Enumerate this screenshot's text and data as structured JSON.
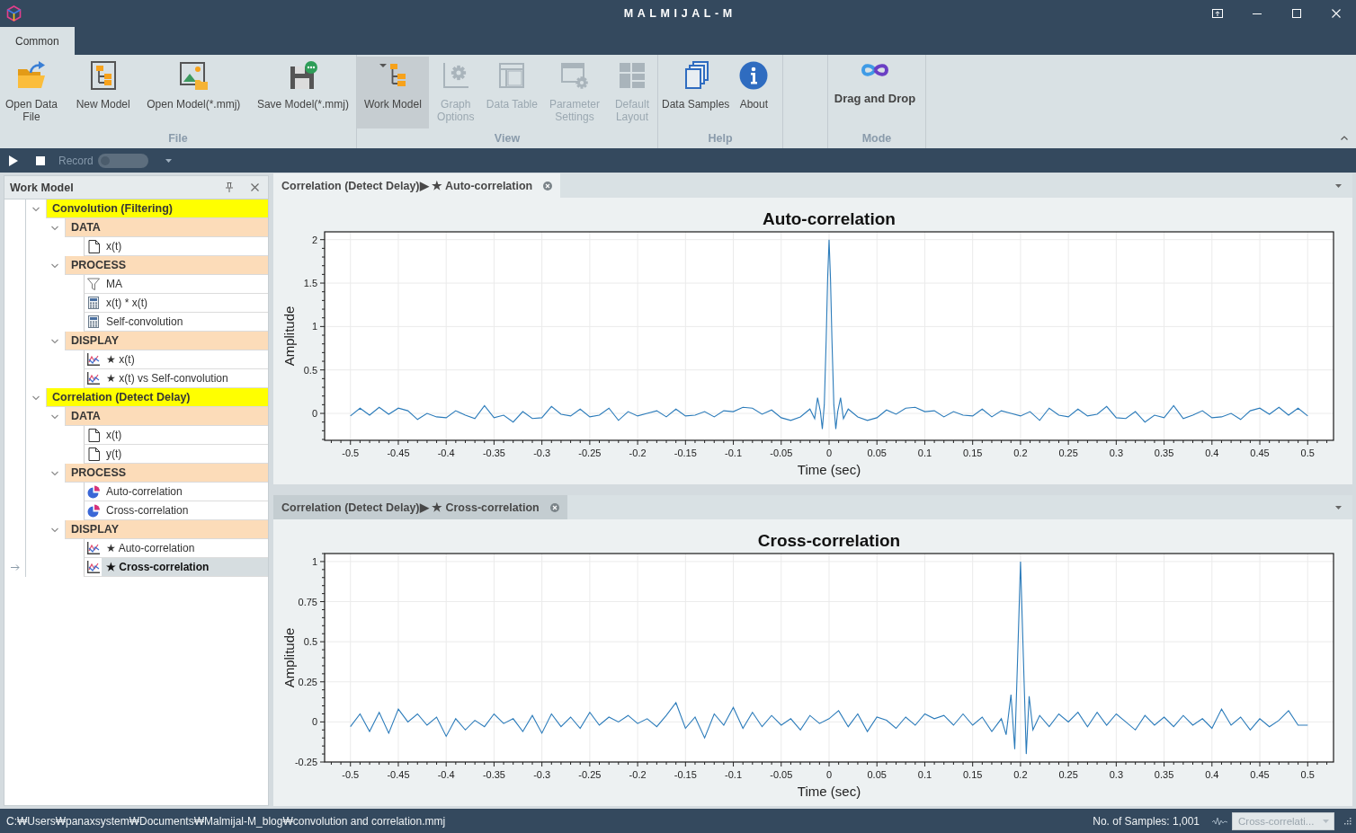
{
  "window": {
    "title": "MALMIJAL-M"
  },
  "ribbon": {
    "tabs": [
      {
        "label": "Common",
        "selected": true
      }
    ],
    "groups": [
      {
        "label": "File",
        "buttons": [
          {
            "kind": "open",
            "label": "Open Data File",
            "active": false,
            "disabled": false
          },
          {
            "kind": "new",
            "label": "New Model",
            "active": false,
            "disabled": false
          },
          {
            "kind": "load",
            "label": "Open Model(*.mmj)",
            "active": false,
            "disabled": false
          },
          {
            "kind": "save",
            "label": "Save Model(*.mmj)",
            "active": false,
            "disabled": false
          }
        ]
      },
      {
        "label": "View",
        "buttons": [
          {
            "kind": "tree",
            "label": "Work Model",
            "active": true,
            "disabled": false
          },
          {
            "kind": "graph",
            "label": "Graph Options",
            "active": false,
            "disabled": true
          },
          {
            "kind": "table",
            "label": "Data Table",
            "active": false,
            "disabled": true
          },
          {
            "kind": "params",
            "label": "Parameter Settings",
            "active": false,
            "disabled": true
          },
          {
            "kind": "layout",
            "label": "Default Layout",
            "active": false,
            "disabled": true
          }
        ]
      },
      {
        "label": "Help",
        "buttons": [
          {
            "kind": "samples",
            "label": "Data Samples",
            "active": false,
            "disabled": false
          },
          {
            "kind": "about",
            "label": "About",
            "active": false,
            "disabled": false
          }
        ]
      },
      {
        "label": "Mode",
        "buttons": [
          {
            "kind": "mode",
            "label": "Drag and Drop",
            "active": false,
            "disabled": false
          }
        ]
      }
    ]
  },
  "toolbar": {
    "record": {
      "label": "Record",
      "disabled": true,
      "on": false
    }
  },
  "work_model": {
    "title": "Work Model",
    "tree": [
      {
        "label": "Convolution (Filtering)",
        "kind": "model",
        "expanded": true,
        "selected": false,
        "children": [
          {
            "label": "DATA",
            "kind": "group",
            "expanded": true,
            "selected": false,
            "children": [
              {
                "label": "x(t)",
                "kind": "data",
                "selected": false
              }
            ]
          },
          {
            "label": "PROCESS",
            "kind": "group",
            "expanded": true,
            "selected": false,
            "children": [
              {
                "label": "MA",
                "kind": "filter",
                "selected": false
              },
              {
                "label": "x(t) * x(t)",
                "kind": "calc",
                "selected": false
              },
              {
                "label": "Self-convolution",
                "kind": "calc",
                "selected": false
              }
            ]
          },
          {
            "label": "DISPLAY",
            "kind": "group",
            "expanded": true,
            "selected": false,
            "children": [
              {
                "label": "★ x(t)",
                "kind": "display",
                "selected": false
              },
              {
                "label": "★ x(t) vs Self-convolution",
                "kind": "display",
                "selected": false
              }
            ]
          }
        ]
      },
      {
        "label": "Correlation (Detect Delay)",
        "kind": "model",
        "expanded": true,
        "selected": false,
        "children": [
          {
            "label": "DATA",
            "kind": "group",
            "expanded": true,
            "selected": false,
            "children": [
              {
                "label": "x(t)",
                "kind": "data",
                "selected": false
              },
              {
                "label": "y(t)",
                "kind": "data",
                "selected": false
              }
            ]
          },
          {
            "label": "PROCESS",
            "kind": "group",
            "expanded": true,
            "selected": false,
            "children": [
              {
                "label": "Auto-correlation",
                "kind": "correlation",
                "selected": false
              },
              {
                "label": "Cross-correlation",
                "kind": "correlation",
                "selected": false
              }
            ]
          },
          {
            "label": "DISPLAY",
            "kind": "group",
            "expanded": true,
            "selected": false,
            "children": [
              {
                "label": "★ Auto-correlation",
                "kind": "display",
                "selected": false
              },
              {
                "label": "★ Cross-correlation",
                "kind": "display",
                "selected": true
              }
            ]
          }
        ]
      }
    ]
  },
  "documents": [
    {
      "tab": "Correlation (Detect Delay)▶ ★ Auto-correlation",
      "focused": true,
      "chart_data": {
        "type": "line",
        "title": "Auto-correlation",
        "xlabel": "Time (sec)",
        "ylabel": "Amplitude",
        "x": [
          -0.5,
          -0.49,
          -0.48,
          -0.47,
          -0.46,
          -0.45,
          -0.44,
          -0.43,
          -0.42,
          -0.41,
          -0.4,
          -0.39,
          -0.38,
          -0.37,
          -0.36,
          -0.35,
          -0.34,
          -0.33,
          -0.32,
          -0.31,
          -0.3,
          -0.29,
          -0.28,
          -0.27,
          -0.26,
          -0.25,
          -0.24,
          -0.23,
          -0.22,
          -0.21,
          -0.2,
          -0.19,
          -0.18,
          -0.17,
          -0.16,
          -0.15,
          -0.14,
          -0.13,
          -0.12,
          -0.11,
          -0.1,
          -0.09,
          -0.08,
          -0.07,
          -0.06,
          -0.05,
          -0.04,
          -0.03,
          -0.02,
          -0.015,
          -0.012,
          -0.009,
          -0.007,
          -0.005,
          -0.003,
          -0.0015,
          0,
          0.0015,
          0.003,
          0.005,
          0.007,
          0.009,
          0.012,
          0.015,
          0.02,
          0.03,
          0.04,
          0.05,
          0.06,
          0.07,
          0.08,
          0.09,
          0.1,
          0.11,
          0.12,
          0.13,
          0.14,
          0.15,
          0.16,
          0.17,
          0.18,
          0.19,
          0.2,
          0.21,
          0.22,
          0.23,
          0.24,
          0.25,
          0.26,
          0.27,
          0.28,
          0.29,
          0.3,
          0.31,
          0.32,
          0.33,
          0.34,
          0.35,
          0.36,
          0.37,
          0.38,
          0.39,
          0.4,
          0.41,
          0.42,
          0.43,
          0.44,
          0.45,
          0.46,
          0.47,
          0.48,
          0.49,
          0.5
        ],
        "series": [
          {
            "color": "#2b7bba",
            "values": [
              -0.03,
              0.06,
              -0.02,
              0.07,
              -0.01,
              0.06,
              0.03,
              -0.07,
              0.0,
              -0.04,
              -0.05,
              0.03,
              -0.02,
              -0.06,
              0.09,
              -0.05,
              -0.02,
              -0.1,
              0.02,
              -0.06,
              -0.05,
              0.08,
              -0.01,
              -0.03,
              0.05,
              -0.04,
              -0.02,
              0.06,
              -0.08,
              0.02,
              -0.03,
              0.0,
              0.03,
              -0.04,
              0.05,
              -0.03,
              -0.02,
              0.02,
              -0.04,
              0.03,
              0.02,
              0.07,
              0.06,
              -0.01,
              0.04,
              -0.05,
              -0.08,
              -0.04,
              0.05,
              -0.06,
              0.18,
              0.02,
              -0.18,
              0.1,
              0.85,
              1.55,
              2.0,
              1.55,
              0.85,
              0.1,
              -0.18,
              0.02,
              0.18,
              -0.06,
              0.05,
              -0.04,
              -0.08,
              -0.05,
              0.04,
              -0.01,
              0.06,
              0.07,
              0.02,
              0.03,
              -0.04,
              0.02,
              -0.02,
              -0.03,
              0.05,
              -0.04,
              0.03,
              0.0,
              -0.03,
              0.02,
              -0.08,
              0.06,
              -0.02,
              -0.04,
              0.05,
              -0.03,
              -0.01,
              0.08,
              -0.05,
              -0.06,
              0.02,
              -0.1,
              -0.02,
              -0.05,
              0.09,
              -0.06,
              -0.02,
              0.03,
              -0.05,
              -0.04,
              0.0,
              -0.07,
              0.03,
              0.06,
              -0.01,
              0.07,
              -0.02,
              0.06,
              -0.03
            ]
          }
        ],
        "xlim": [
          -0.527,
          0.527
        ],
        "ylim": [
          -0.31,
          2.09
        ],
        "xticks": [
          -0.5,
          -0.45,
          -0.4,
          -0.35,
          -0.3,
          -0.25,
          -0.2,
          -0.15,
          -0.1,
          -0.05,
          0,
          0.05,
          0.1,
          0.15,
          0.2,
          0.25,
          0.3,
          0.35,
          0.4,
          0.45,
          0.5
        ],
        "yticks": [
          0,
          0.5,
          1,
          1.5,
          2
        ],
        "grid": true
      }
    },
    {
      "tab": "Correlation (Detect Delay)▶ ★ Cross-correlation",
      "focused": false,
      "chart_data": {
        "type": "line",
        "title": "Cross-correlation",
        "xlabel": "Time (sec)",
        "ylabel": "Amplitude",
        "x": [
          -0.5,
          -0.49,
          -0.48,
          -0.47,
          -0.46,
          -0.45,
          -0.44,
          -0.43,
          -0.42,
          -0.41,
          -0.4,
          -0.39,
          -0.38,
          -0.37,
          -0.36,
          -0.35,
          -0.34,
          -0.33,
          -0.32,
          -0.31,
          -0.3,
          -0.29,
          -0.28,
          -0.27,
          -0.26,
          -0.25,
          -0.24,
          -0.23,
          -0.22,
          -0.21,
          -0.2,
          -0.19,
          -0.18,
          -0.17,
          -0.16,
          -0.15,
          -0.14,
          -0.13,
          -0.12,
          -0.11,
          -0.1,
          -0.09,
          -0.08,
          -0.07,
          -0.06,
          -0.05,
          -0.04,
          -0.03,
          -0.02,
          -0.01,
          0,
          0.01,
          0.02,
          0.03,
          0.04,
          0.05,
          0.06,
          0.07,
          0.08,
          0.09,
          0.1,
          0.11,
          0.12,
          0.13,
          0.14,
          0.15,
          0.16,
          0.17,
          0.18,
          0.185,
          0.19,
          0.194,
          0.197,
          0.2,
          0.203,
          0.206,
          0.209,
          0.213,
          0.22,
          0.23,
          0.24,
          0.25,
          0.26,
          0.27,
          0.28,
          0.29,
          0.3,
          0.31,
          0.32,
          0.33,
          0.34,
          0.35,
          0.36,
          0.37,
          0.38,
          0.39,
          0.4,
          0.41,
          0.42,
          0.43,
          0.44,
          0.45,
          0.46,
          0.47,
          0.48,
          0.49,
          0.5
        ],
        "series": [
          {
            "color": "#2b7bba",
            "values": [
              -0.03,
              0.05,
              -0.06,
              0.06,
              -0.07,
              0.08,
              0.0,
              0.05,
              -0.02,
              0.03,
              -0.09,
              0.02,
              -0.05,
              0.01,
              -0.03,
              0.05,
              -0.01,
              0.02,
              -0.06,
              0.04,
              -0.07,
              0.05,
              -0.03,
              0.03,
              -0.04,
              0.06,
              -0.02,
              0.03,
              0.0,
              0.04,
              -0.01,
              0.02,
              -0.03,
              0.04,
              0.12,
              -0.04,
              0.03,
              -0.1,
              0.05,
              -0.02,
              0.09,
              -0.04,
              0.06,
              -0.03,
              0.04,
              -0.02,
              0.02,
              -0.05,
              0.04,
              -0.01,
              0.02,
              0.07,
              -0.03,
              0.05,
              -0.06,
              0.03,
              0.01,
              -0.04,
              0.03,
              -0.02,
              0.05,
              0.02,
              0.04,
              -0.02,
              0.05,
              -0.02,
              0.03,
              -0.06,
              0.02,
              -0.08,
              0.17,
              -0.17,
              0.4,
              1.0,
              0.4,
              -0.2,
              0.16,
              -0.05,
              0.04,
              -0.03,
              0.05,
              0.0,
              0.06,
              -0.03,
              0.06,
              -0.02,
              0.05,
              0.0,
              -0.05,
              0.04,
              -0.02,
              0.03,
              -0.03,
              0.04,
              -0.02,
              0.02,
              -0.04,
              0.08,
              -0.02,
              0.03,
              -0.05,
              0.02,
              -0.03,
              0.01,
              0.07,
              -0.02,
              -0.02
            ]
          }
        ],
        "xlim": [
          -0.527,
          0.527
        ],
        "ylim": [
          -0.25,
          1.05
        ],
        "xticks": [
          -0.5,
          -0.45,
          -0.4,
          -0.35,
          -0.3,
          -0.25,
          -0.2,
          -0.15,
          -0.1,
          -0.05,
          0,
          0.05,
          0.1,
          0.15,
          0.2,
          0.25,
          0.3,
          0.35,
          0.4,
          0.45,
          0.5
        ],
        "yticks": [
          -0.25,
          0,
          0.25,
          0.5,
          0.75,
          1
        ],
        "grid": true
      }
    }
  ],
  "status_bar": {
    "path": "C:₩Users₩panaxsystem₩Documents₩Malmijal-M_blog₩convolution and correlation.mmj",
    "samples": "No. of Samples: 1,001",
    "view_select": {
      "value": "Cross-correlati...",
      "disabled": true
    }
  }
}
